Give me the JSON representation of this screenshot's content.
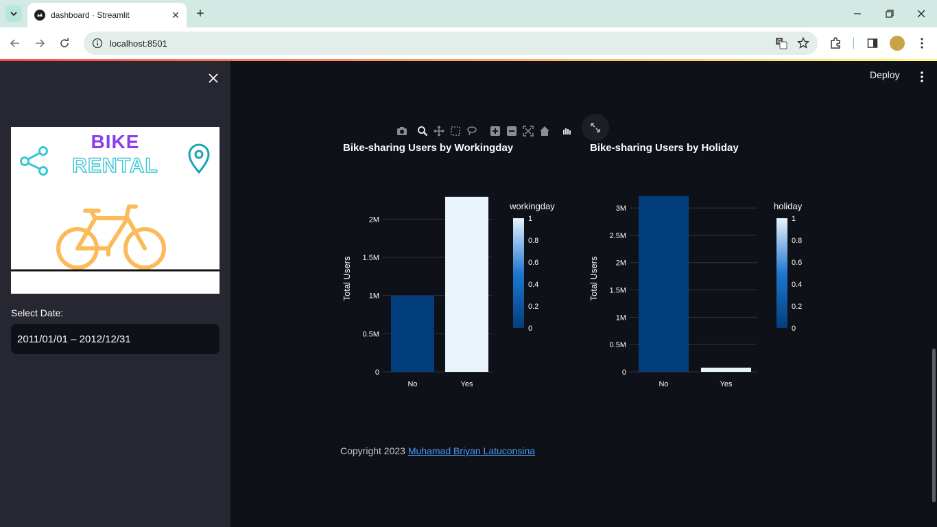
{
  "browser": {
    "tab_title": "dashboard · Streamlit",
    "url": "localhost:8501"
  },
  "sidebar": {
    "logo_bike": "BIKE",
    "logo_rental": "RENTAL",
    "date_label": "Select Date:",
    "date_value": "2011/01/01 – 2012/12/31"
  },
  "header": {
    "deploy_label": "Deploy"
  },
  "charts": {
    "workingday_title": "Bike-sharing Users by Workingday",
    "holiday_title": "Bike-sharing Users by Holiday"
  },
  "footer": {
    "prefix": "Copyright 2023 ",
    "author_link": "Muhamad Briyan Latuconsina"
  },
  "colors": {
    "accent_low": "#023e7d",
    "accent_high": "#e8f3fc",
    "link": "#4a9cf5"
  },
  "chart_data": [
    {
      "type": "bar",
      "categories": [
        "No",
        "Yes"
      ],
      "values": [
        1000269,
        2292410
      ],
      "color_values": [
        0,
        1
      ],
      "ylabel": "Total Users",
      "ylim": [
        0,
        2300000
      ],
      "yticks": [
        0,
        500000,
        1000000,
        1500000,
        2000000
      ],
      "ytick_labels": [
        "0",
        "0.5M",
        "1M",
        "1.5M",
        "2M"
      ],
      "legend_title": "workingday",
      "colorbar_ticks": [
        "0",
        "0.2",
        "0.4",
        "0.6",
        "0.8",
        "1"
      ],
      "grid": true
    },
    {
      "type": "bar",
      "categories": [
        "No",
        "Yes"
      ],
      "values": [
        3214244,
        78435
      ],
      "color_values": [
        0,
        1
      ],
      "ylabel": "Total Users",
      "ylim": [
        0,
        3214244
      ],
      "yticks": [
        0,
        500000,
        1000000,
        1500000,
        2000000,
        2500000,
        3000000
      ],
      "ytick_labels": [
        "0",
        "0.5M",
        "1M",
        "1.5M",
        "2M",
        "2.5M",
        "3M"
      ],
      "legend_title": "holiday",
      "colorbar_ticks": [
        "0",
        "0.2",
        "0.4",
        "0.6",
        "0.8",
        "1"
      ],
      "grid": true
    }
  ]
}
